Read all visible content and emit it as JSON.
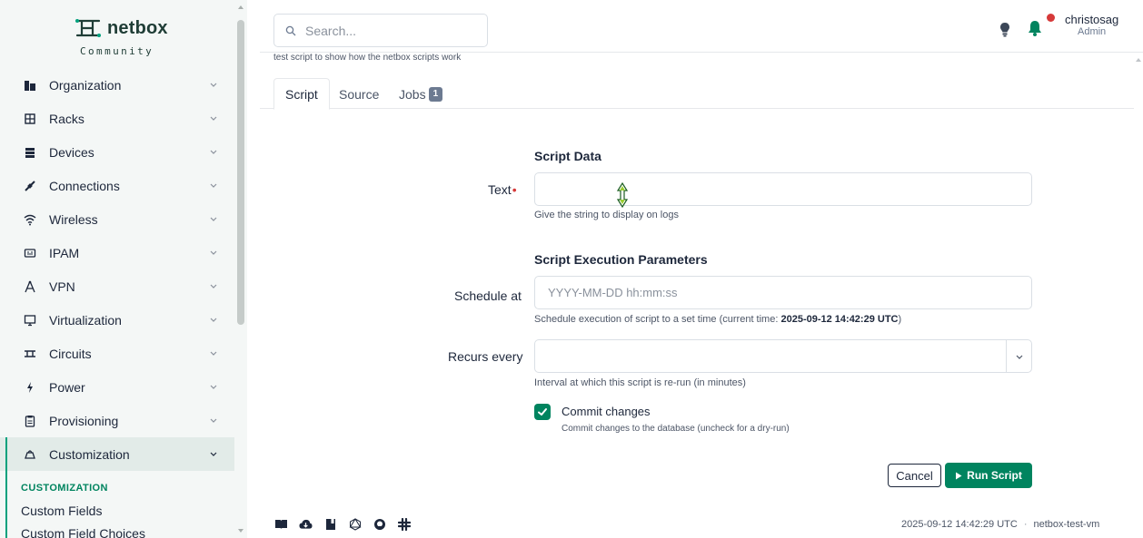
{
  "brand": {
    "name": "netbox",
    "tagline": "Community"
  },
  "sidebar": {
    "items": [
      {
        "label": "Organization",
        "icon": "organization-icon"
      },
      {
        "label": "Racks",
        "icon": "rack-icon"
      },
      {
        "label": "Devices",
        "icon": "devices-icon"
      },
      {
        "label": "Connections",
        "icon": "connections-icon"
      },
      {
        "label": "Wireless",
        "icon": "wireless-icon"
      },
      {
        "label": "IPAM",
        "icon": "ipam-icon"
      },
      {
        "label": "VPN",
        "icon": "vpn-icon"
      },
      {
        "label": "Virtualization",
        "icon": "virtualization-icon"
      },
      {
        "label": "Circuits",
        "icon": "circuits-icon"
      },
      {
        "label": "Power",
        "icon": "power-icon"
      },
      {
        "label": "Provisioning",
        "icon": "provisioning-icon"
      },
      {
        "label": "Customization",
        "icon": "customization-icon"
      }
    ],
    "submenu": {
      "heading": "CUSTOMIZATION",
      "links": [
        "Custom Fields",
        "Custom Field Choices"
      ]
    }
  },
  "header": {
    "search_placeholder": "Search...",
    "user_name": "christosag",
    "user_role": "Admin"
  },
  "script": {
    "description": "test script to show how the netbox scripts work"
  },
  "tabs": [
    {
      "label": "Script",
      "active": true
    },
    {
      "label": "Source",
      "active": false
    },
    {
      "label": "Jobs",
      "active": false,
      "badge": "1"
    }
  ],
  "form": {
    "script_data_title": "Script Data",
    "text_label": "Text",
    "text_required_marker": "•",
    "text_value": "",
    "text_help": "Give the string to display on logs",
    "exec_params_title": "Script Execution Parameters",
    "schedule_label": "Schedule at",
    "schedule_placeholder": "YYYY-MM-DD hh:mm:ss",
    "schedule_help_prefix": "Schedule execution of script to a set time (current time: ",
    "schedule_help_time": "2025-09-12 14:42:29 UTC",
    "schedule_help_suffix": ")",
    "recurs_label": "Recurs every",
    "recurs_value": "",
    "recurs_help": "Interval at which this script is re-run (in minutes)",
    "commit_label": "Commit changes",
    "commit_checked": true,
    "commit_help": "Commit changes to the database (uncheck for a dry-run)",
    "cancel_label": "Cancel",
    "run_label": "Run Script"
  },
  "footer": {
    "timestamp": "2025-09-12 14:42:29 UTC",
    "separator": "·",
    "hostname": "netbox-test-vm"
  },
  "colors": {
    "brand_green": "#00845f",
    "sidebar_bg": "#f4f7f6",
    "danger": "#d63939"
  }
}
